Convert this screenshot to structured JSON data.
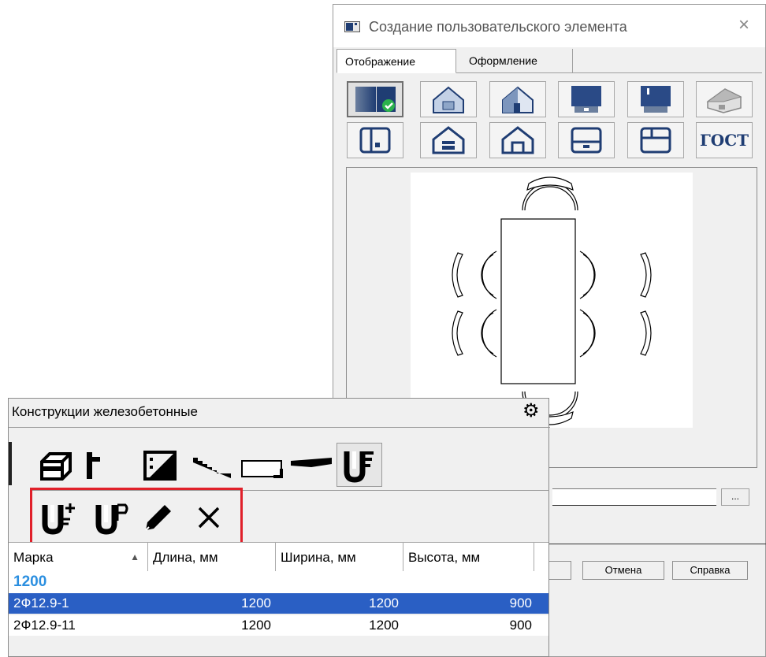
{
  "dialog": {
    "title": "Создание пользовательского элемента",
    "close_glyph": "×",
    "tabs": [
      {
        "label": "Отображение",
        "active": true
      },
      {
        "label": "Оформление",
        "active": false
      }
    ],
    "toolbar_row1_icons": [
      "view-2d-check-icon",
      "house-3d-light-icon",
      "house-3d-icon",
      "box-3d-front-icon",
      "box-3d-side-icon",
      "house-3d-gray-icon"
    ],
    "toolbar_row2_icons": [
      "plan-square-icon",
      "house-outline-filled-door-icon",
      "house-outline-icon",
      "plan-bottom-icon",
      "plan-top-icon"
    ],
    "gost_label": "ГОСТ",
    "browse_label": "...",
    "cancel_label": "Отмена",
    "help_label": "Справка"
  },
  "panel": {
    "title": "Конструкции железобетонные",
    "struct_icons": [
      "block-icon",
      "column-icon",
      "wall-panel-icon",
      "stair-icon",
      "slab-icon",
      "beam-icon",
      "custom-element-icon"
    ],
    "actions": [
      {
        "name": "add-element-icon",
        "glyph": "+"
      },
      {
        "name": "add-group-icon",
        "glyph": "P"
      },
      {
        "name": "edit-pencil-icon",
        "glyph": ""
      },
      {
        "name": "delete-x-icon",
        "glyph": "×"
      }
    ],
    "table": {
      "columns": [
        {
          "label": "Марка",
          "sort": "▲"
        },
        {
          "label": "Длина, мм"
        },
        {
          "label": "Ширина, мм"
        },
        {
          "label": "Высота, мм"
        }
      ],
      "group": "1200",
      "rows": [
        {
          "mark": "2Ф12.9-1",
          "length": "1200",
          "width": "1200",
          "height": "900",
          "selected": true
        },
        {
          "mark": "2Ф12.9-11",
          "length": "1200",
          "width": "1200",
          "height": "900",
          "selected": false
        }
      ]
    }
  },
  "colors": {
    "accent_blue": "#1f3d73",
    "selection": "#2a5fc4",
    "group_text": "#2b8fe0",
    "highlight_red": "#e0202a",
    "check_green": "#2bb24c"
  }
}
